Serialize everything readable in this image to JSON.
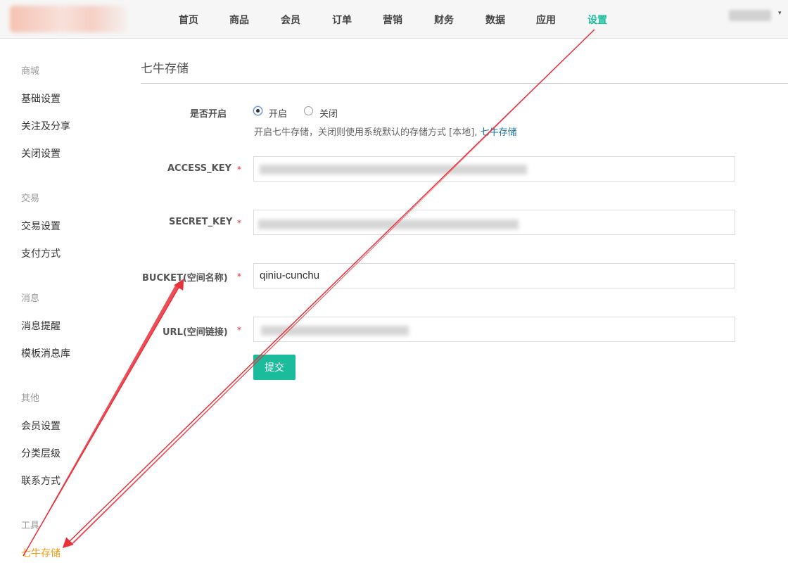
{
  "nav": {
    "items": [
      {
        "label": "首页"
      },
      {
        "label": "商品"
      },
      {
        "label": "会员"
      },
      {
        "label": "订单"
      },
      {
        "label": "营销"
      },
      {
        "label": "财务"
      },
      {
        "label": "数据"
      },
      {
        "label": "应用"
      },
      {
        "label": "设置",
        "active": true
      }
    ],
    "accent_color": "#1abc9c"
  },
  "sidebar": {
    "groups": [
      {
        "title": "商城",
        "items": [
          "基础设置",
          "关注及分享",
          "关闭设置"
        ]
      },
      {
        "title": "交易",
        "items": [
          "交易设置",
          "支付方式"
        ]
      },
      {
        "title": "消息",
        "items": [
          "消息提醒",
          "模板消息库"
        ]
      },
      {
        "title": "其他",
        "items": [
          "会员设置",
          "分类层级",
          "联系方式"
        ]
      },
      {
        "title": "工具",
        "items": [
          "七牛存储"
        ]
      }
    ],
    "active_item": "七牛存储",
    "active_color": "#f39c12"
  },
  "main": {
    "title": "七牛存储",
    "enable": {
      "label": "是否开启",
      "options": [
        "开启",
        "关闭"
      ],
      "selected": "开启",
      "help_text": "开启七牛存储，关闭则使用系统默认的存储方式 [本地],",
      "help_link": "七牛存储"
    },
    "fields": [
      {
        "label": "ACCESS_KEY",
        "required": "*",
        "value": ""
      },
      {
        "label": "SECRET_KEY",
        "required": "*",
        "value": ""
      },
      {
        "label": "BUCKET(空间名称)",
        "required": "*",
        "value": "qiniu-cunchu"
      },
      {
        "label": "URL(空间链接)",
        "required": "*",
        "value": ""
      }
    ],
    "submit_label": "提交",
    "submit_color": "#1abc9c"
  },
  "annotation": {
    "arrow_color": "#e8303a"
  }
}
